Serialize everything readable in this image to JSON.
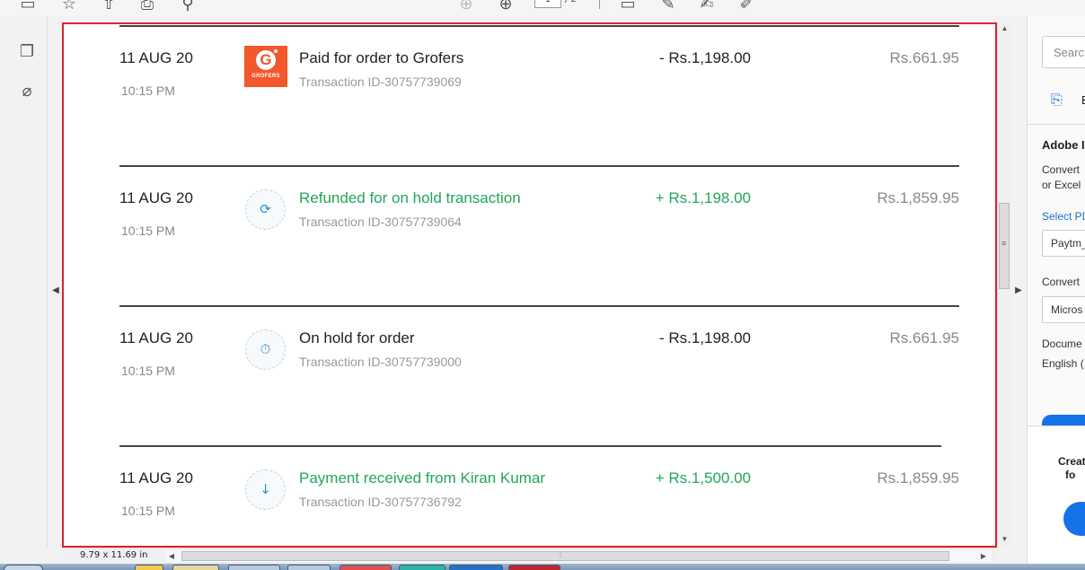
{
  "toolbar": {
    "page_current": "1",
    "page_total": "/ 2"
  },
  "transactions": [
    {
      "date": "11 AUG 20",
      "time": "10:15 PM",
      "title": "Paid for order to Grofers",
      "transaction_id": "Transaction ID-30757739069",
      "amount": "- Rs.1,198.00",
      "balance": "Rs.661.95",
      "icon": "grofers-logo",
      "logo_letter": "G",
      "logo_text": "GROFERS",
      "credit": false
    },
    {
      "date": "11 AUG 20",
      "time": "10:15 PM",
      "title": "Refunded for on hold transaction",
      "transaction_id": "Transaction ID-30757739064",
      "amount": "+ Rs.1,198.00",
      "balance": "Rs.1,859.95",
      "icon": "refund-icon",
      "credit": true
    },
    {
      "date": "11 AUG 20",
      "time": "10:15 PM",
      "title": "On hold for order",
      "transaction_id": "Transaction ID-30757739000",
      "amount": "- Rs.1,198.00",
      "balance": "Rs.661.95",
      "icon": "on-hold-icon",
      "credit": false
    },
    {
      "date": "11 AUG 20",
      "time": "10:15 PM",
      "title": "Payment received from Kiran Kumar",
      "transaction_id": "Transaction ID-30757736792",
      "amount": "+ Rs.1,500.00",
      "balance": "Rs.1,859.95",
      "icon": "payment-received-icon",
      "credit": true
    }
  ],
  "colors": {
    "credit_green": "#21a65a",
    "frame_red": "#d9242b",
    "accent_blue": "#1473e6"
  },
  "right_panel": {
    "search_placeholder": "Search",
    "export_label": "E",
    "heading": "Adobe I",
    "desc_line1": "Convert",
    "desc_line2": "or Excel",
    "select_label": "Select PD",
    "file_value": "Paytm_",
    "convert_label": "Convert",
    "format_value": "Micros",
    "doc_lang_label": "Docume",
    "doc_lang_value": "English (",
    "create_line1": "Creat",
    "create_line2": "fo"
  },
  "status": {
    "page_size": "9.79 x 11.69 in"
  }
}
